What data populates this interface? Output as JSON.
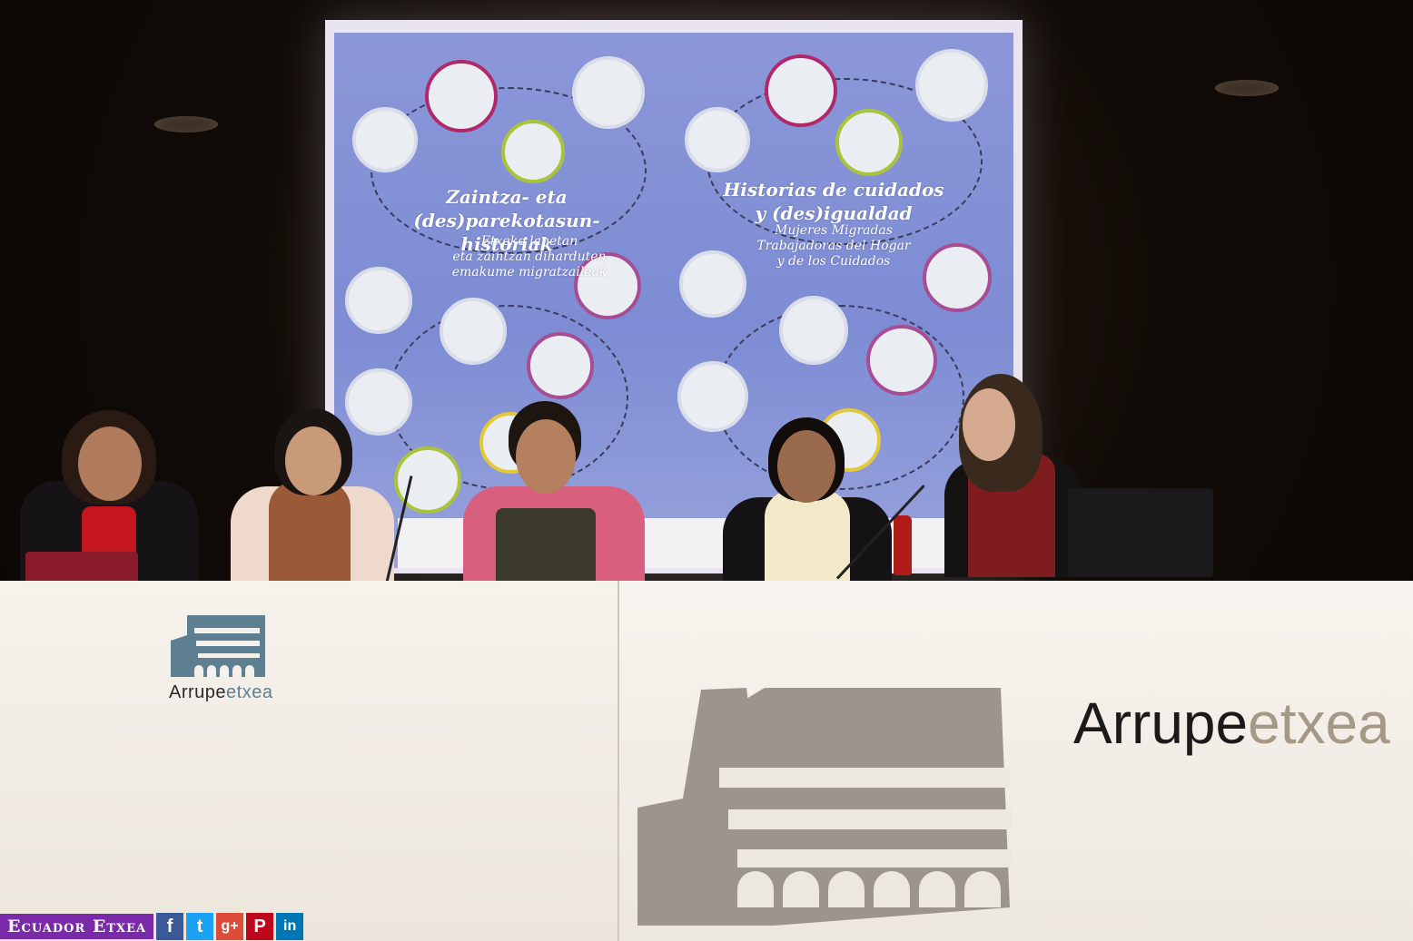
{
  "slide": {
    "left_title": [
      "Zaintza- eta",
      "(des)parekotasun-historiak"
    ],
    "left_subtitle": [
      "Etxeko lanetan",
      "eta zaintzan diharduten",
      "emakume migratzaileak"
    ],
    "right_title": [
      "Historias de cuidados",
      "y (des)igualdad"
    ],
    "right_subtitle": [
      "Mujeres Migradas",
      "Trabajadoras del Hogar",
      "y de los Cuidados"
    ]
  },
  "table": {
    "small_brand_main": "Arrupe",
    "small_brand_light": "etxea",
    "big_brand_main": "Arrupe",
    "big_brand_light": "etxea"
  },
  "watermark": {
    "text": "Ecuador Etxea",
    "icons": [
      {
        "name": "facebook-icon",
        "glyph": "f",
        "color": "#3b5998"
      },
      {
        "name": "twitter-icon",
        "glyph": "t",
        "color": "#1da1f2"
      },
      {
        "name": "google-plus-icon",
        "glyph": "g+",
        "color": "#dd4b39"
      },
      {
        "name": "pinterest-icon",
        "glyph": "P",
        "color": "#bd081c"
      },
      {
        "name": "linkedin-icon",
        "glyph": "in",
        "color": "#0077b5"
      }
    ]
  }
}
